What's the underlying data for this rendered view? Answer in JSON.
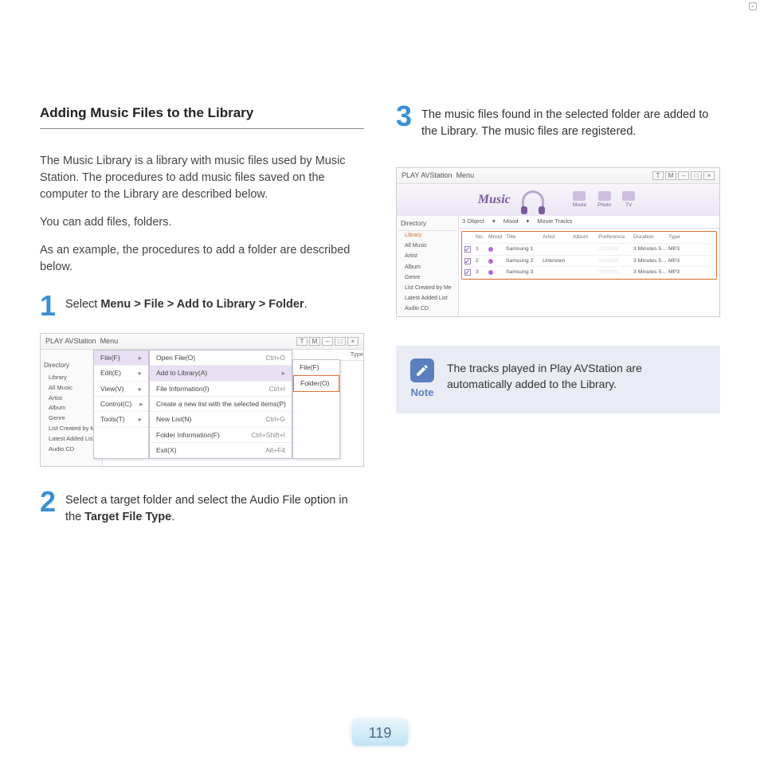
{
  "title": "Adding Music Files to the Library",
  "intro": [
    "The Music Library is a library with music files used by Music Station. The procedures to add music files saved on the computer to the Library are described below.",
    "You can add files, folders.",
    "As an example, the procedures to add a folder are described below."
  ],
  "steps": {
    "s1": {
      "num": "1",
      "pre": "Select ",
      "bold": "Menu > File > Add to Library > Folder",
      "post": "."
    },
    "s2": {
      "num": "2",
      "pre": "Select a target folder and select the Audio File option in the ",
      "bold": "Target File Type",
      "post": "."
    },
    "s3": {
      "num": "3",
      "text": "The music files found in the selected folder are added to the Library. The music files are registered."
    }
  },
  "shot1": {
    "app_title": "PLAY AVStation",
    "menu_label": "Menu",
    "win_buttons": [
      "T",
      "M",
      "–",
      "□",
      "×"
    ],
    "directory_label": "Directory",
    "tree": [
      "Library",
      "All Music",
      "Artist",
      "Album",
      "Genre",
      "List Created by Me",
      "Latest Added List",
      "Audio CD"
    ],
    "menu1": [
      {
        "label": "File(F)",
        "sel": true,
        "arrow": true
      },
      {
        "label": "Edit(E)",
        "arrow": true
      },
      {
        "label": "View(V)",
        "arrow": true
      },
      {
        "label": "Control(C)",
        "arrow": true
      },
      {
        "label": "Tools(T)",
        "arrow": true
      }
    ],
    "menu2": [
      {
        "label": "Open File(O)",
        "sc": "Ctrl+O"
      },
      {
        "label": "Add to Library(A)",
        "sel": true,
        "arrow": true
      },
      {
        "label": "File Information(I)",
        "sc": "Ctrl+I"
      },
      {
        "label": "Create a new list with the selected items(P)"
      },
      {
        "label": "New List(N)",
        "sc": "Ctrl+G"
      },
      {
        "label": "Folder Information(F)",
        "sc": "Ctrl+Shift+I"
      },
      {
        "label": "Exit(X)",
        "sc": "Alt+F4"
      }
    ],
    "menu3": [
      {
        "label": "File(F)"
      },
      {
        "label": "Folder(O)",
        "hl": true
      }
    ],
    "grid_head": "Type"
  },
  "shot2": {
    "app_title": "PLAY AVStation",
    "menu_label": "Menu",
    "heading": "Music",
    "modes": [
      "Movie",
      "Photo",
      "TV"
    ],
    "directory_label": "Directory",
    "tree": [
      {
        "label": "Library",
        "hl": true
      },
      {
        "label": "All Music"
      },
      {
        "label": "Artist"
      },
      {
        "label": "Album"
      },
      {
        "label": "Genre"
      },
      {
        "label": "List Created by Me"
      },
      {
        "label": "Latest Added List"
      },
      {
        "label": "Audio CD"
      }
    ],
    "tabs": [
      "3 Object",
      "Mood",
      "Movie Tracks"
    ],
    "columns": [
      "",
      "No.",
      "Mood",
      "Title",
      "Artist",
      "Album",
      "Preference",
      "Duration",
      "Type"
    ],
    "rows": [
      {
        "no": "1",
        "title": "Samsung 1",
        "artist": "",
        "album": "",
        "pref": "☆☆☆☆☆",
        "dur": "3 Minutes 5…",
        "type": "MP3"
      },
      {
        "no": "2",
        "title": "Samsung 2",
        "artist": "Unknown",
        "album": "",
        "pref": "☆☆☆☆☆",
        "dur": "3 Minutes 5…",
        "type": "MP3"
      },
      {
        "no": "3",
        "title": "Samsung 3",
        "artist": "",
        "album": "",
        "pref": "☆☆☆☆☆",
        "dur": "3 Minutes 5…",
        "type": "MP3"
      }
    ]
  },
  "note": {
    "label": "Note",
    "text": "The tracks played in Play AVStation are automatically added to the Library."
  },
  "page_number": "119"
}
